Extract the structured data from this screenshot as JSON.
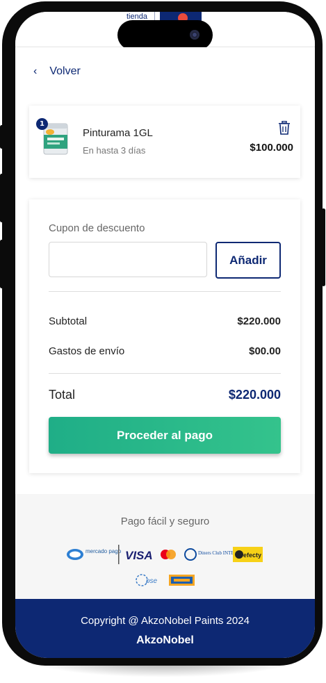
{
  "header": {
    "tienda_label": "tienda"
  },
  "nav": {
    "back_label": "Volver",
    "back_icon": "chevron-left-icon"
  },
  "cart": {
    "items": [
      {
        "quantity": "1",
        "name": "Pinturama 1GL",
        "delivery": "En hasta 3 días",
        "price": "$100.000",
        "delete_icon": "trash-icon"
      }
    ]
  },
  "summary": {
    "coupon_label": "Cupon de descuento",
    "coupon_value": "",
    "add_button": "Añadir",
    "subtotal_label": "Subtotal",
    "subtotal_value": "$220.000",
    "shipping_label": "Gastos de envío",
    "shipping_value": "$00.00",
    "total_label": "Total",
    "total_value": "$220.000",
    "checkout_button": "Proceder al pago"
  },
  "payment": {
    "title": "Pago fácil y seguro",
    "methods": [
      "mercado pago",
      "VISA",
      "Diners Club INTERNATIONAL",
      "efecty",
      "pse"
    ]
  },
  "footer": {
    "copyright": "Copyright @ AkzoNobel Paints 2024",
    "brand": "AkzoNobel"
  },
  "colors": {
    "primary": "#0d2873",
    "checkout_green": "#27b889",
    "footer_bg": "#0d2873"
  }
}
